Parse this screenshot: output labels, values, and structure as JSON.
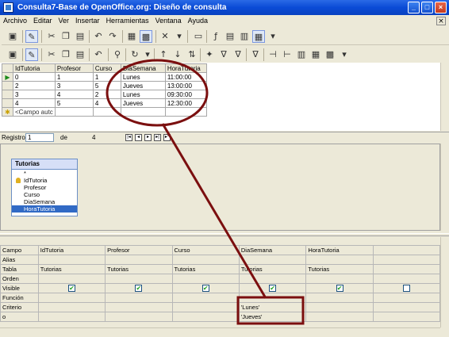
{
  "window": {
    "title": "Consulta7-Base de OpenOffice.org: Diseño de consulta"
  },
  "menu": [
    "Archivo",
    "Editar",
    "Ver",
    "Insertar",
    "Herramientas",
    "Ventana",
    "Ayuda"
  ],
  "results": {
    "columns": [
      "IdTutoria",
      "Profesor",
      "Curso",
      "DiaSemana",
      "HoraTutoria"
    ],
    "rows": [
      [
        "0",
        "1",
        "1",
        "Lunes",
        "11:00:00"
      ],
      [
        "2",
        "3",
        "5",
        "Jueves",
        "13:00:00"
      ],
      [
        "3",
        "4",
        "2",
        "Lunes",
        "09:30:00"
      ],
      [
        "4",
        "5",
        "4",
        "Jueves",
        "12:30:00"
      ]
    ],
    "new_row_placeholder": "<Campo autc"
  },
  "navigation": {
    "label": "Registro",
    "current": "1",
    "of_label": "de",
    "total": "4"
  },
  "table_box": {
    "title": "Tutorias",
    "fields": [
      "*",
      "IdTutoria",
      "Profesor",
      "Curso",
      "DiaSemana",
      "HoraTutoria"
    ],
    "key_field": "IdTutoria",
    "selected_field": "HoraTutoria"
  },
  "criteria_grid": {
    "row_labels": [
      "Campo",
      "Alias",
      "Tabla",
      "Orden",
      "Visible",
      "Función",
      "Criterio",
      "o"
    ],
    "columns": [
      {
        "campo": "IdTutoria",
        "tabla": "Tutorias",
        "visible": true,
        "criterio": "",
        "o": ""
      },
      {
        "campo": "Profesor",
        "tabla": "Tutorias",
        "visible": true,
        "criterio": "",
        "o": ""
      },
      {
        "campo": "Curso",
        "tabla": "Tutorias",
        "visible": true,
        "criterio": "",
        "o": ""
      },
      {
        "campo": "DiaSemana",
        "tabla": "Tutorias",
        "visible": true,
        "criterio": "'Lunes'",
        "o": "'Jueves'"
      },
      {
        "campo": "HoraTutoria",
        "tabla": "Tutorias",
        "visible": true,
        "criterio": "",
        "o": ""
      },
      {
        "campo": "",
        "tabla": "",
        "visible": false,
        "criterio": "",
        "o": ""
      }
    ]
  },
  "colors": {
    "annotation": "#7B0F0F",
    "titlebar": "#0A4BD6",
    "selection": "#316AC5"
  }
}
